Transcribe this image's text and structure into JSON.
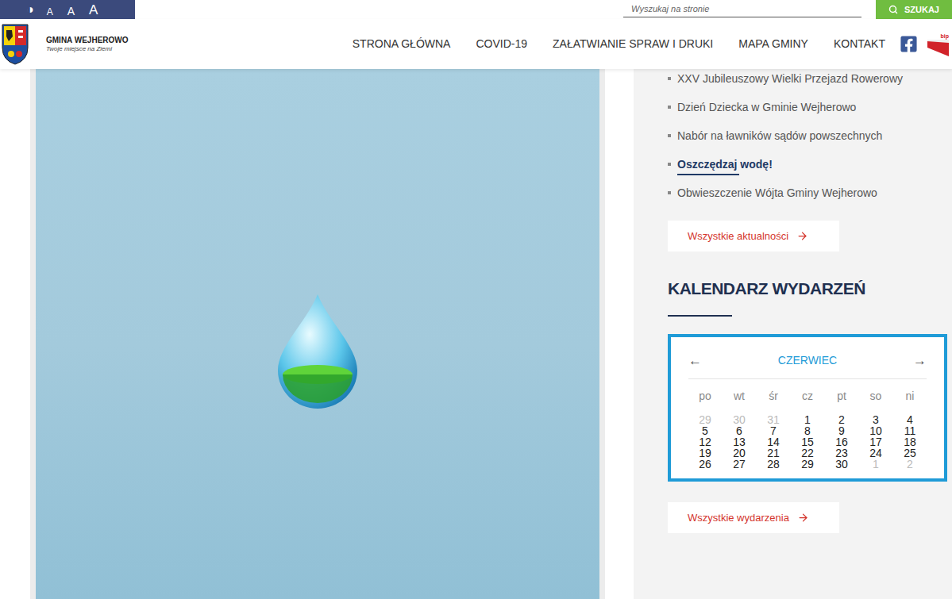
{
  "accessibility": {
    "contrast": "◑",
    "font_sizes": [
      "A",
      "A",
      "A"
    ]
  },
  "search": {
    "placeholder": "Wyszukaj na stronie",
    "button": "SZUKAJ"
  },
  "logo": {
    "title": "GMINA WEJHEROWO",
    "subtitle": "Twoje miejsce na Ziemi"
  },
  "nav": [
    "STRONA GŁÓWNA",
    "COVID-19",
    "ZAŁATWIANIE SPRAW I DRUKI",
    "MAPA GMINY",
    "KONTAKT"
  ],
  "bip": "bip",
  "news": [
    {
      "title": "XXV Jubileuszowy Wielki Przejazd Rowerowy",
      "selected": false
    },
    {
      "title": "Dzień Dziecka w Gminie Wejherowo",
      "selected": false
    },
    {
      "title": "Nabór na ławników sądów powszechnych",
      "selected": false
    },
    {
      "title": "Oszczędzaj wodę!",
      "selected": true
    },
    {
      "title": "Obwieszczenie Wójta Gminy Wejherowo",
      "selected": false
    }
  ],
  "news_button": "Wszystkie aktualności",
  "calendar": {
    "heading": "KALENDARZ WYDARZEŃ",
    "month": "CZERWIEC",
    "prev": "←",
    "next": "→",
    "weekdays": [
      "po",
      "wt",
      "śr",
      "cz",
      "pt",
      "so",
      "ni"
    ],
    "weeks": [
      [
        {
          "day": "29",
          "current": false
        },
        {
          "day": "30",
          "current": false
        },
        {
          "day": "31",
          "current": false
        },
        {
          "day": "1",
          "current": true
        },
        {
          "day": "2",
          "current": true
        },
        {
          "day": "3",
          "current": true
        },
        {
          "day": "4",
          "current": true
        }
      ],
      [
        {
          "day": "5",
          "current": true
        },
        {
          "day": "6",
          "current": true
        },
        {
          "day": "7",
          "current": true
        },
        {
          "day": "8",
          "current": true
        },
        {
          "day": "9",
          "current": true
        },
        {
          "day": "10",
          "current": true
        },
        {
          "day": "11",
          "current": true
        }
      ],
      [
        {
          "day": "12",
          "current": true
        },
        {
          "day": "13",
          "current": true
        },
        {
          "day": "14",
          "current": true
        },
        {
          "day": "15",
          "current": true
        },
        {
          "day": "16",
          "current": true
        },
        {
          "day": "17",
          "current": true
        },
        {
          "day": "18",
          "current": true
        }
      ],
      [
        {
          "day": "19",
          "current": true
        },
        {
          "day": "20",
          "current": true
        },
        {
          "day": "21",
          "current": true
        },
        {
          "day": "22",
          "current": true
        },
        {
          "day": "23",
          "current": true
        },
        {
          "day": "24",
          "current": true
        },
        {
          "day": "25",
          "current": true
        }
      ],
      [
        {
          "day": "26",
          "current": true
        },
        {
          "day": "27",
          "current": true
        },
        {
          "day": "28",
          "current": true
        },
        {
          "day": "29",
          "current": true
        },
        {
          "day": "30",
          "current": true
        },
        {
          "day": "1",
          "current": false
        },
        {
          "day": "2",
          "current": false
        }
      ]
    ]
  },
  "events_button": "Wszystkie wydarzenia"
}
